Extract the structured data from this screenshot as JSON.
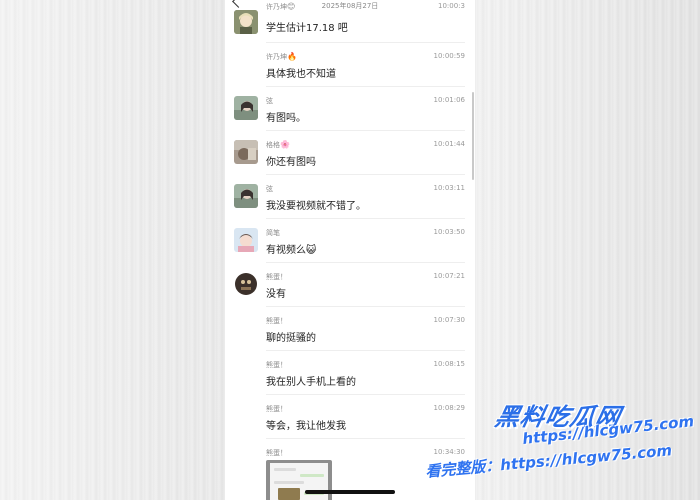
{
  "header": {
    "date": "2025年08月27日"
  },
  "messages": [
    {
      "sender": "许乃坤",
      "sender_emoji": "😊",
      "time": "10:00:3",
      "text": "学生估计17.18 吧",
      "avatar": "anime-girl-avatar"
    },
    {
      "sender": "许乃坤",
      "sender_emoji": "🔥",
      "time": "10:00:59",
      "text": "具体我也不知道",
      "avatar": ""
    },
    {
      "sender": "弦",
      "sender_emoji": "",
      "time": "10:01:06",
      "text": "有图吗。",
      "avatar": "girl-photo-avatar"
    },
    {
      "sender": "格格",
      "sender_emoji": "🌸",
      "time": "10:01:44",
      "text": "你还有图吗",
      "avatar": "blurred-photo-avatar"
    },
    {
      "sender": "弦",
      "sender_emoji": "",
      "time": "10:03:11",
      "text": "我没要视频就不错了。",
      "avatar": "girl-photo-avatar"
    },
    {
      "sender": "简笔",
      "sender_emoji": "",
      "time": "10:03:50",
      "text": "有视频么",
      "text_emoji": "😺",
      "avatar": "cartoon-avatar"
    },
    {
      "sender": "熊蛋！",
      "sender_emoji": "",
      "time": "10:07:21",
      "text": "没有",
      "avatar": "dark-character-avatar"
    },
    {
      "sender": "熊蛋！",
      "sender_emoji": "",
      "time": "10:07:30",
      "text": "聊的挺骚的",
      "avatar": ""
    },
    {
      "sender": "熊蛋！",
      "sender_emoji": "",
      "time": "10:08:15",
      "text": "我在别人手机上看的",
      "avatar": ""
    },
    {
      "sender": "熊蛋！",
      "sender_emoji": "",
      "time": "10:08:29",
      "text": "等会，我让他发我",
      "avatar": ""
    },
    {
      "sender": "熊蛋！",
      "sender_emoji": "",
      "time": "10:34:30",
      "text": "",
      "avatar": "",
      "attachment": "chat-screenshot-image"
    }
  ],
  "watermark": {
    "title": "黑料吃瓜网",
    "url": "https://hlcgw75.com",
    "latest_prefix": "看完整版：",
    "latest_url": "https://hlcgw75.com",
    "color": "#2b6fe8"
  }
}
